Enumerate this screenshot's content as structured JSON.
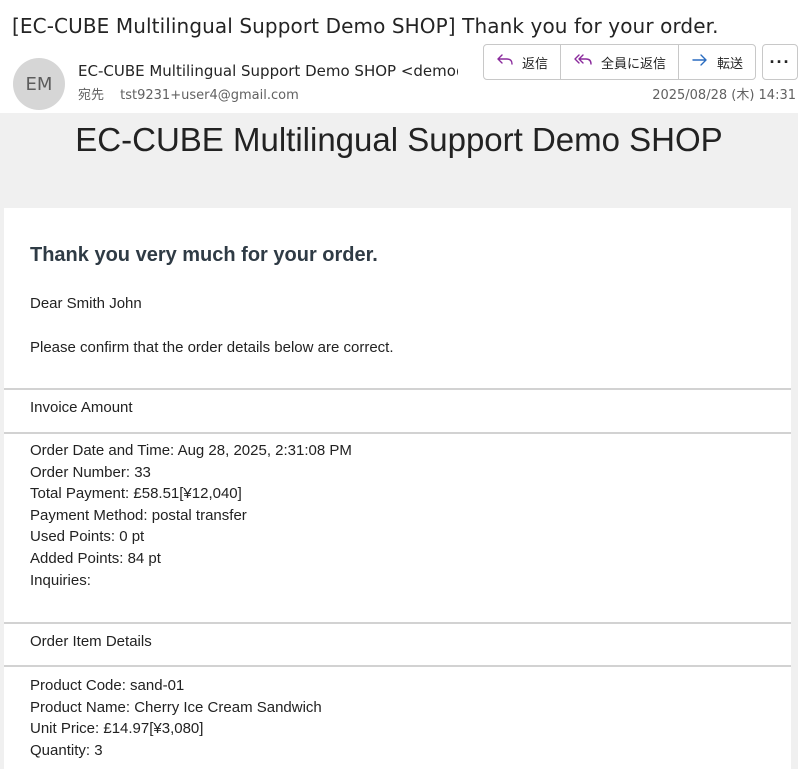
{
  "email": {
    "subject": "[EC-CUBE Multilingual Support Demo SHOP] Thank you for your order.",
    "avatar_initials": "EM",
    "sender": "EC-CUBE Multilingual Support Demo SHOP <demo@ec-cube.net>",
    "to_label": "宛先",
    "recipient": "tst9231+user4@gmail.com",
    "date": "2025/08/28 (木) 14:31",
    "actions": {
      "reply": "返信",
      "reply_all": "全員に返信",
      "forward": "転送",
      "more": "···"
    }
  },
  "body": {
    "shop_title": "EC-CUBE Multilingual Support Demo SHOP",
    "heading": "Thank you very much for your order.",
    "greeting": "Dear Smith John",
    "confirm_text": "Please confirm that the order details below are correct.",
    "invoice_section_title": "Invoice Amount",
    "invoice_lines": [
      "Order Date and Time: Aug 28, 2025, 2:31:08 PM",
      "Order Number: 33",
      "Total Payment: £58.51[¥12,040]",
      "Payment Method: postal transfer",
      "Used Points: 0 pt",
      "Added Points: 84 pt",
      "Inquiries:"
    ],
    "items_section_title": "Order Item Details",
    "item_lines": [
      "Product Code: sand-01",
      "Product Name: Cherry Ice Cream Sandwich",
      "Unit Price: £14.97[¥3,080]",
      "Quantity: 3"
    ]
  },
  "colors": {
    "reply_icon": "#8a2a9c",
    "forward_icon": "#2a6cc0",
    "body_background": "#f0f0f0",
    "heading_text": "#2f3b45"
  },
  "icons": {
    "reply": "reply-icon",
    "reply_all": "reply-all-icon",
    "forward": "forward-arrow-icon",
    "more": "more-dots-icon"
  }
}
